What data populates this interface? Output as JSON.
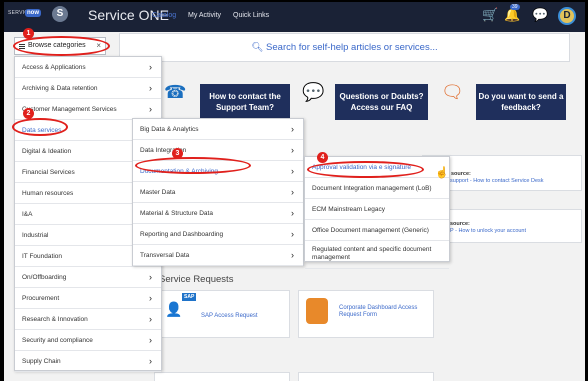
{
  "header": {
    "logo_small": "SERVICE",
    "logo_now": "now",
    "badge_letter": "S",
    "title": "Service ONE",
    "nav": [
      "Catalog",
      "My Activity",
      "Quick Links"
    ],
    "cart_count": "39",
    "avatar_letter": "D"
  },
  "search": {
    "browse_label": "Browse categories",
    "close_glyph": "×",
    "placeholder": "Search for self-help articles or services..."
  },
  "banners": [
    "How to contact the Support Team?",
    "Questions or Doubts? Access our FAQ",
    "Do you want to send a feedback?"
  ],
  "info": {
    "source_label": "source:",
    "link1": "support - How to contact Service Desk",
    "link2": "P - How to unlock your account"
  },
  "service_requests": {
    "title": "Service Requests",
    "cards": [
      "SAP Access Request",
      "Corporate Dashboard Access Request Form"
    ],
    "sap_logo": "SAP"
  },
  "categories": [
    "Access & Applications",
    "Archiving & Data retention",
    "Customer Management Services",
    "Data services",
    "Digital & Ideation",
    "Financial Services",
    "Human resources",
    "I&A",
    "Industrial",
    "IT Foundation",
    "On/Offboarding",
    "Procurement",
    "Research & Innovation",
    "Security and compliance",
    "Supply Chain"
  ],
  "data_services": [
    "Big Data & Analytics",
    "Data Integration",
    "Documentation & Archiving",
    "Master Data",
    "Material & Structure Data",
    "Reporting and Dashboarding",
    "Transversal Data"
  ],
  "documentation": [
    "Approval validation via e signature",
    "Document Integration management (LoB)",
    "ECM Mainstream Legacy",
    "Office Document management (Generic)",
    "Regulated content and specific document management"
  ],
  "annotations": [
    "1",
    "2",
    "3",
    "4"
  ],
  "colors": {
    "header_bg": "#1a2236",
    "accent": "#3a68c9",
    "annotation": "#e0201c",
    "banner_bg": "#1f2f5c"
  }
}
